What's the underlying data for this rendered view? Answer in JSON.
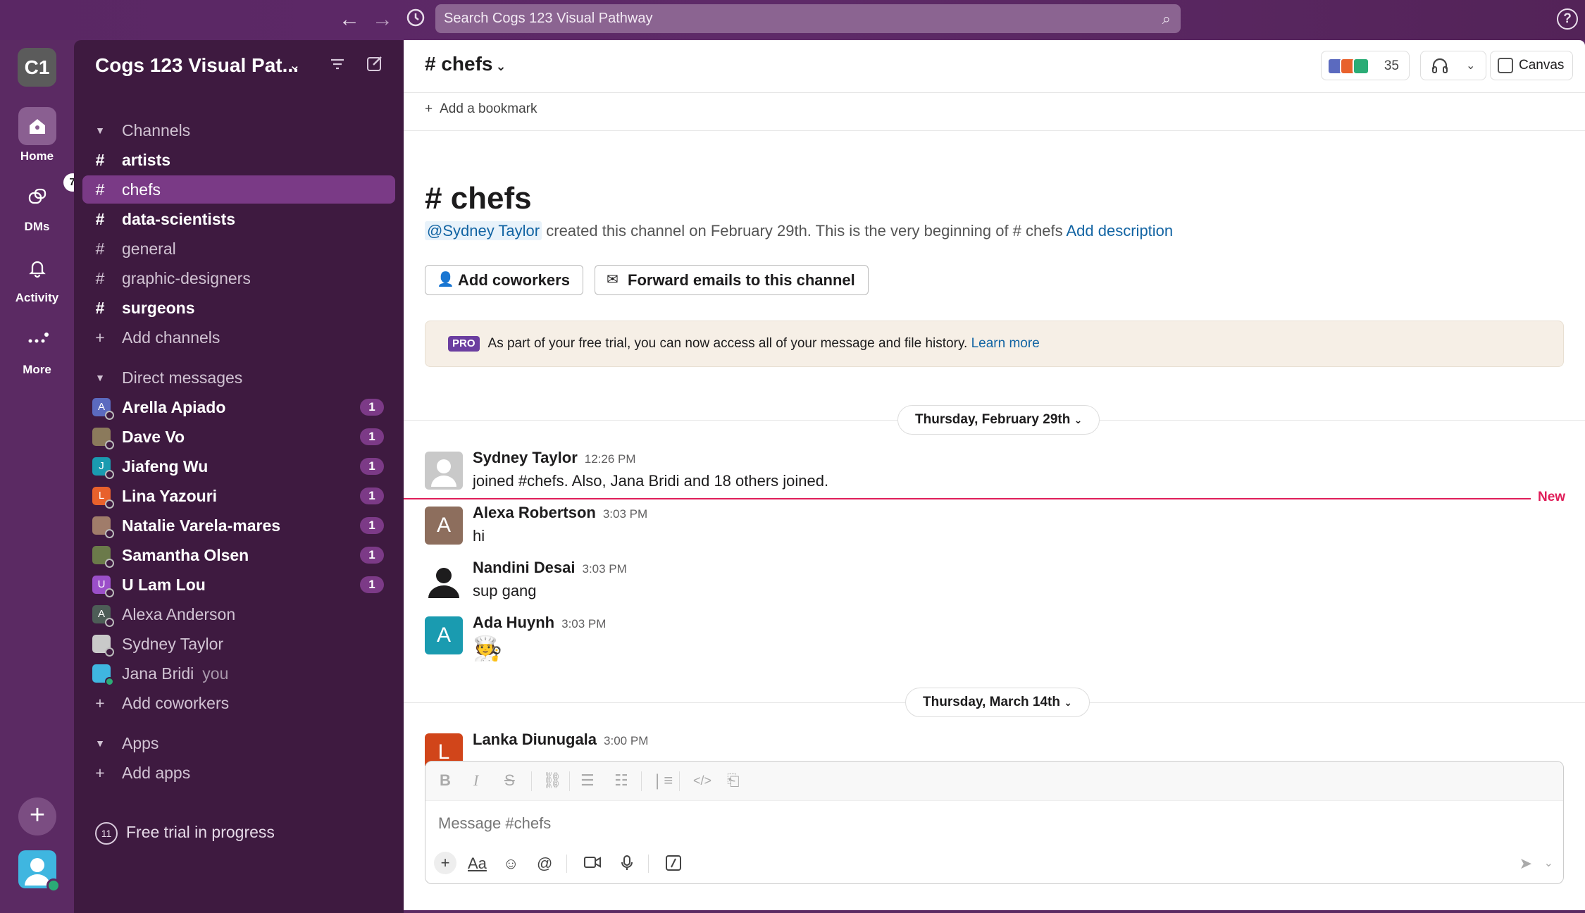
{
  "search": {
    "placeholder": "Search Cogs 123 Visual Pathway"
  },
  "rail": {
    "workspace_initials": "C1",
    "items": [
      {
        "label": "Home",
        "icon": "home-icon"
      },
      {
        "label": "DMs",
        "icon": "dms-icon",
        "badge": "7"
      },
      {
        "label": "Activity",
        "icon": "bell-icon"
      },
      {
        "label": "More",
        "icon": "more-icon"
      }
    ]
  },
  "sidebar": {
    "workspace_name": "Cogs 123 Visual Pat...",
    "channels_header": "Channels",
    "channels": [
      {
        "name": "artists",
        "bold": true
      },
      {
        "name": "chefs",
        "selected": true
      },
      {
        "name": "data-scientists",
        "bold": true
      },
      {
        "name": "general"
      },
      {
        "name": "graphic-designers"
      },
      {
        "name": "surgeons",
        "bold": true
      }
    ],
    "add_channels": "Add channels",
    "dm_header": "Direct messages",
    "dms": [
      {
        "name": "Arella Apiado",
        "initial": "A",
        "color": "#5b6abf",
        "count": "1",
        "bold": true
      },
      {
        "name": "Dave Vo",
        "initial": "",
        "color": "#8b7a5c",
        "count": "1",
        "bold": true
      },
      {
        "name": "Jiafeng Wu",
        "initial": "J",
        "color": "#1a9bb0",
        "count": "1",
        "bold": true
      },
      {
        "name": "Lina Yazouri",
        "initial": "L",
        "color": "#e8612c",
        "count": "1",
        "bold": true
      },
      {
        "name": "Natalie Varela-mares",
        "initial": "",
        "color": "#a07c6a",
        "count": "1",
        "bold": true
      },
      {
        "name": "Samantha Olsen",
        "initial": "",
        "color": "#6b7a4a",
        "count": "1",
        "bold": true
      },
      {
        "name": "U Lam Lou",
        "initial": "U",
        "color": "#9b4fc9",
        "count": "1",
        "bold": true
      },
      {
        "name": "Alexa Anderson",
        "initial": "A",
        "color": "#4d5d57"
      },
      {
        "name": "Sydney Taylor",
        "initial": "",
        "color": "#c9c9c9"
      },
      {
        "name": "Jana Bridi",
        "initial": "",
        "color": "#3fb6e0",
        "you": "you",
        "online": true
      }
    ],
    "add_coworkers": "Add coworkers",
    "apps_header": "Apps",
    "add_apps": "Add apps",
    "trial_days": "11",
    "trial_text": "Free trial in progress"
  },
  "header": {
    "channel": "# chefs",
    "member_count": "35",
    "canvas_label": "Canvas",
    "bookmark": "Add a bookmark"
  },
  "intro": {
    "title": "# chefs",
    "creator": "@Sydney Taylor",
    "text": " created this channel on February 29th. This is the very beginning of # chefs ",
    "add_description": "Add description",
    "add_coworkers_btn": "Add coworkers",
    "forward_btn": "Forward emails to this channel"
  },
  "pro_banner": {
    "tag": "PRO",
    "text": "As part of your free trial, you can now access all of your message and file history. ",
    "link": "Learn more"
  },
  "date_separators": [
    "Thursday, February 29th",
    "Thursday, March 14th"
  ],
  "new_label": "New",
  "messages": [
    {
      "author": "Sydney Taylor",
      "time": "12:26 PM",
      "text": "joined #chefs. Also, Jana Bridi and 18 others joined.",
      "avatar_letter": "",
      "avatar_color": "#c9c9c9"
    },
    {
      "author": "Alexa Robertson",
      "time": "3:03 PM",
      "text": "hi",
      "avatar_letter": "A",
      "avatar_color": "#8d6e5d"
    },
    {
      "author": "Nandini Desai",
      "time": "3:03 PM",
      "text": "sup gang",
      "avatar_letter": "",
      "avatar_color": "#ffffff"
    },
    {
      "author": "Ada Huynh",
      "time": "3:03 PM",
      "text": "🧑‍🍳",
      "avatar_letter": "A",
      "avatar_color": "#1a9bb0"
    },
    {
      "author": "Lanka Diunugala",
      "time": "3:00 PM",
      "text": "",
      "avatar_letter": "L",
      "avatar_color": "#d1451a"
    }
  ],
  "composer": {
    "placeholder": "Message #chefs"
  }
}
